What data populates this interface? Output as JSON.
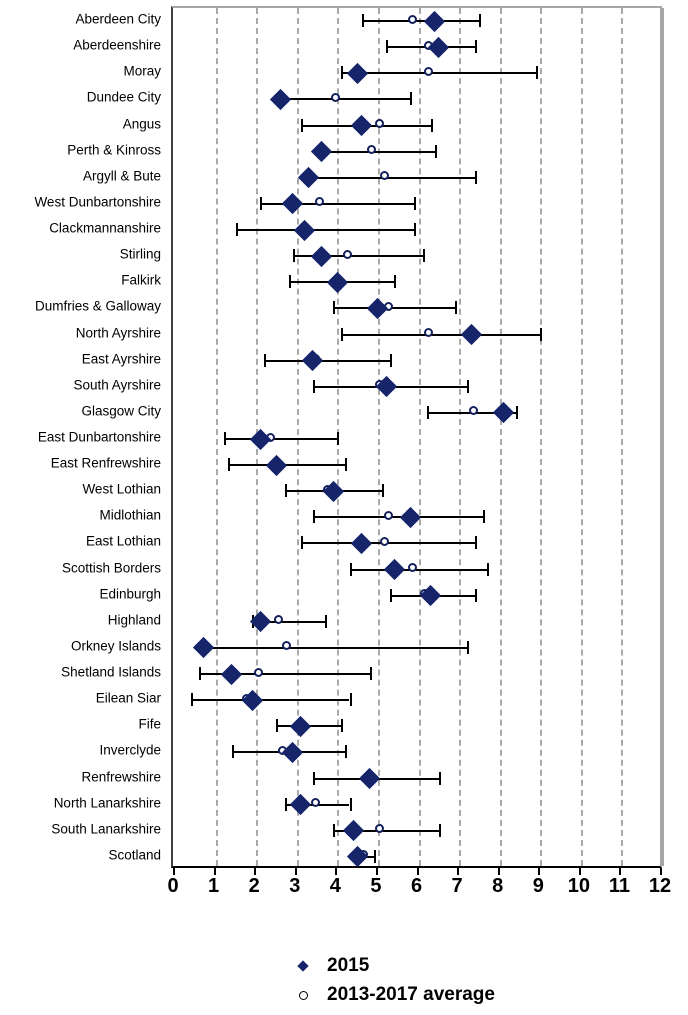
{
  "chart_data": {
    "type": "scatter",
    "title": "",
    "subtitle": "",
    "xlabel": "",
    "ylabel": "",
    "xlim": [
      0,
      12
    ],
    "xticks": [
      "0",
      "1",
      "2",
      "3",
      "4",
      "5",
      "6",
      "7",
      "8",
      "9",
      "10",
      "11",
      "12"
    ],
    "grid": true,
    "legend_position": "bottom",
    "legend": [
      {
        "key": "diamond-filled",
        "label": "2015",
        "color": "#16246a"
      },
      {
        "key": "circle-open",
        "label": "2013-2017 average",
        "color": "#000000"
      }
    ],
    "series": [
      {
        "name": "2015",
        "marker": "diamond-filled",
        "color": "#16246a"
      },
      {
        "name": "2013-2017 average",
        "marker": "circle-open",
        "color": "#000000"
      }
    ],
    "categories": [
      "Aberdeen City",
      "Aberdeenshire",
      "Moray",
      "Dundee City",
      "Angus",
      "Perth & Kinross",
      "Argyll & Bute",
      "West Dunbartonshire",
      "Clackmannanshire",
      "Stirling",
      "Falkirk",
      "Dumfries & Galloway",
      "North Ayrshire",
      "East Ayrshire",
      "South Ayrshire",
      "Glasgow City",
      "East Dunbartonshire",
      "East Renfrewshire",
      "West Lothian",
      "Midlothian",
      "East Lothian",
      "Scottish Borders",
      "Edinburgh",
      "Highland",
      "Orkney Islands",
      "Shetland Islands",
      "Eilean Siar",
      "Fife",
      "Inverclyde",
      "Renfrewshire",
      "North Lanarkshire",
      "South Lanarkshire",
      "Scotland"
    ],
    "rows": [
      {
        "category": "Aberdeen City",
        "value_2015": 6.4,
        "average": 5.9,
        "ci_low": 4.6,
        "ci_high": 7.5
      },
      {
        "category": "Aberdeenshire",
        "value_2015": 6.5,
        "average": 6.3,
        "ci_low": 5.2,
        "ci_high": 7.4
      },
      {
        "category": "Moray",
        "value_2015": 4.5,
        "average": 6.3,
        "ci_low": 4.1,
        "ci_high": 8.9
      },
      {
        "category": "Dundee City",
        "value_2015": 2.6,
        "average": 4.0,
        "ci_low": 2.6,
        "ci_high": 5.8
      },
      {
        "category": "Angus",
        "value_2015": 4.6,
        "average": 5.1,
        "ci_low": 3.1,
        "ci_high": 6.3
      },
      {
        "category": "Perth & Kinross",
        "value_2015": 3.6,
        "average": 4.9,
        "ci_low": 3.5,
        "ci_high": 6.4
      },
      {
        "category": "Argyll & Bute",
        "value_2015": 3.3,
        "average": 5.2,
        "ci_low": 3.2,
        "ci_high": 7.4
      },
      {
        "category": "West Dunbartonshire",
        "value_2015": 2.9,
        "average": 3.6,
        "ci_low": 2.1,
        "ci_high": 5.9
      },
      {
        "category": "Clackmannanshire",
        "value_2015": 3.2,
        "average": 3.2,
        "ci_low": 1.5,
        "ci_high": 5.9
      },
      {
        "category": "Stirling",
        "value_2015": 3.6,
        "average": 4.3,
        "ci_low": 2.9,
        "ci_high": 6.1
      },
      {
        "category": "Falkirk",
        "value_2015": 4.0,
        "average": 4.0,
        "ci_low": 2.8,
        "ci_high": 5.4
      },
      {
        "category": "Dumfries & Galloway",
        "value_2015": 5.0,
        "average": 5.3,
        "ci_low": 3.9,
        "ci_high": 6.9
      },
      {
        "category": "North Ayrshire",
        "value_2015": 7.3,
        "average": 6.3,
        "ci_low": 4.1,
        "ci_high": 9.0
      },
      {
        "category": "East Ayrshire",
        "value_2015": 3.4,
        "average": 3.5,
        "ci_low": 2.2,
        "ci_high": 5.3
      },
      {
        "category": "South Ayrshire",
        "value_2015": 5.2,
        "average": 5.1,
        "ci_low": 3.4,
        "ci_high": 7.2
      },
      {
        "category": "Glasgow City",
        "value_2015": 8.1,
        "average": 7.4,
        "ci_low": 6.2,
        "ci_high": 8.4
      },
      {
        "category": "East Dunbartonshire",
        "value_2015": 2.1,
        "average": 2.4,
        "ci_low": 1.2,
        "ci_high": 4.0
      },
      {
        "category": "East Renfrewshire",
        "value_2015": 2.5,
        "average": 2.5,
        "ci_low": 1.3,
        "ci_high": 4.2
      },
      {
        "category": "West Lothian",
        "value_2015": 3.9,
        "average": 3.8,
        "ci_low": 2.7,
        "ci_high": 5.1
      },
      {
        "category": "Midlothian",
        "value_2015": 5.8,
        "average": 5.3,
        "ci_low": 3.4,
        "ci_high": 7.6
      },
      {
        "category": "East Lothian",
        "value_2015": 4.6,
        "average": 5.2,
        "ci_low": 3.1,
        "ci_high": 7.4
      },
      {
        "category": "Scottish Borders",
        "value_2015": 5.4,
        "average": 5.9,
        "ci_low": 4.3,
        "ci_high": 7.7
      },
      {
        "category": "Edinburgh",
        "value_2015": 6.3,
        "average": 6.2,
        "ci_low": 5.3,
        "ci_high": 7.4
      },
      {
        "category": "Highland",
        "value_2015": 2.1,
        "average": 2.6,
        "ci_low": 1.9,
        "ci_high": 3.7
      },
      {
        "category": "Orkney Islands",
        "value_2015": 0.7,
        "average": 2.8,
        "ci_low": 0.7,
        "ci_high": 7.2
      },
      {
        "category": "Shetland Islands",
        "value_2015": 1.4,
        "average": 2.1,
        "ci_low": 0.6,
        "ci_high": 4.8
      },
      {
        "category": "Eilean Siar",
        "value_2015": 1.9,
        "average": 1.8,
        "ci_low": 0.4,
        "ci_high": 4.3
      },
      {
        "category": "Fife",
        "value_2015": 3.1,
        "average": 3.2,
        "ci_low": 2.5,
        "ci_high": 4.1
      },
      {
        "category": "Inverclyde",
        "value_2015": 2.9,
        "average": 2.7,
        "ci_low": 1.4,
        "ci_high": 4.2
      },
      {
        "category": "Renfrewshire",
        "value_2015": 4.8,
        "average": 4.8,
        "ci_low": 3.4,
        "ci_high": 6.5
      },
      {
        "category": "North Lanarkshire",
        "value_2015": 3.1,
        "average": 3.5,
        "ci_low": 2.7,
        "ci_high": 4.3
      },
      {
        "category": "South Lanarkshire",
        "value_2015": 4.4,
        "average": 5.1,
        "ci_low": 3.9,
        "ci_high": 6.5
      },
      {
        "category": "Scotland",
        "value_2015": 4.5,
        "average": 4.7,
        "ci_low": 4.5,
        "ci_high": 4.9
      }
    ]
  }
}
